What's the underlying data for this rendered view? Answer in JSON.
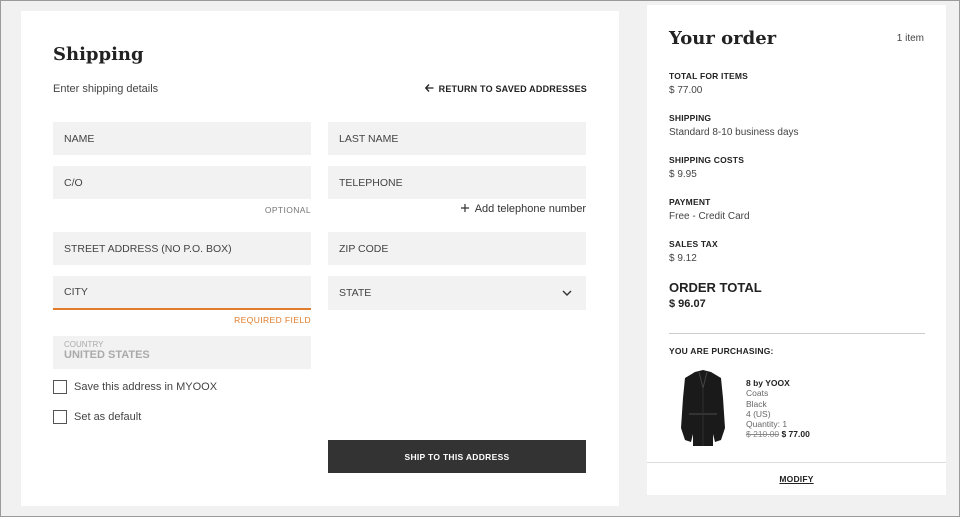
{
  "shipping": {
    "title": "Shipping",
    "subtitle": "Enter shipping details",
    "return_link": "RETURN TO SAVED ADDRESSES",
    "fields": {
      "name": "NAME",
      "last_name": "LAST NAME",
      "co": "C/O",
      "telephone": "TELEPHONE",
      "street": "STREET ADDRESS (NO P.O. BOX)",
      "zip": "ZIP CODE",
      "city": "CITY",
      "state": "STATE"
    },
    "optional_label": "OPTIONAL",
    "add_phone": "Add telephone number",
    "required_label": "REQUIRED FIELD",
    "country_label": "COUNTRY",
    "country_value": "UNITED STATES",
    "save_address": "Save this address in MYOOX",
    "set_default": "Set as default",
    "ship_button": "SHIP TO THIS ADDRESS",
    "accent_color": "#e07c2a"
  },
  "order": {
    "title": "Your order",
    "item_count": "1 item",
    "summary": [
      {
        "label": "TOTAL FOR ITEMS",
        "value": "$ 77.00"
      },
      {
        "label": "SHIPPING",
        "value": "Standard 8-10 business days"
      },
      {
        "label": "SHIPPING COSTS",
        "value": "$ 9.95"
      },
      {
        "label": "PAYMENT",
        "value": "Free - Credit Card"
      },
      {
        "label": "SALES TAX",
        "value": "$ 9.12"
      }
    ],
    "total_label": "ORDER TOTAL",
    "total_value": "$ 96.07",
    "purchasing_label": "YOU ARE PURCHASING:",
    "product": {
      "brand": "8 by YOOX",
      "category": "Coats",
      "color": "Black",
      "size": "4 (US)",
      "quantity": "Quantity: 1",
      "old_price": "$ 210.00",
      "new_price": "$ 77.00"
    },
    "modify": "MODIFY"
  }
}
